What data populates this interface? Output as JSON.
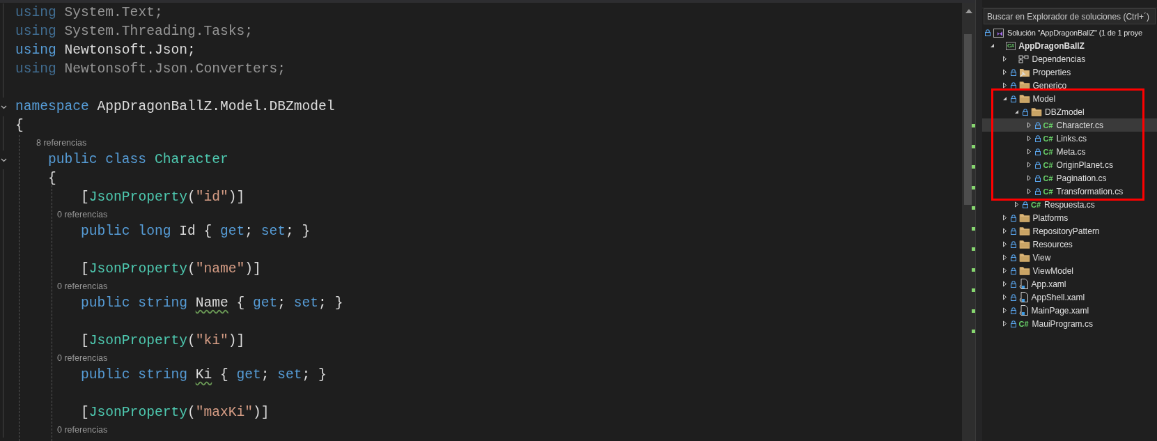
{
  "editor": {
    "lines": [
      {
        "kind": "code",
        "faded": true,
        "foldable": false,
        "tokens": [
          {
            "text": "using",
            "kind": "keyword"
          },
          {
            "text": " System.Text;",
            "kind": "plain"
          }
        ]
      },
      {
        "kind": "code",
        "faded": true,
        "foldable": false,
        "tokens": [
          {
            "text": "using",
            "kind": "keyword"
          },
          {
            "text": " System.Threading.Tasks;",
            "kind": "plain"
          }
        ]
      },
      {
        "kind": "code",
        "faded": false,
        "foldable": false,
        "tokens": [
          {
            "text": "using",
            "kind": "keyword"
          },
          {
            "text": " Newtonsoft.Json;",
            "kind": "plain"
          }
        ]
      },
      {
        "kind": "code",
        "faded": true,
        "foldable": false,
        "tokens": [
          {
            "text": "using",
            "kind": "keyword"
          },
          {
            "text": " Newtonsoft.Json.Converters;",
            "kind": "plain"
          }
        ]
      },
      {
        "kind": "blank"
      },
      {
        "kind": "code",
        "faded": false,
        "foldable": true,
        "tokens": [
          {
            "text": "namespace",
            "kind": "keyword"
          },
          {
            "text": " AppDragonBallZ.Model.DBZmodel",
            "kind": "plain"
          }
        ]
      },
      {
        "kind": "code",
        "faded": false,
        "foldable": false,
        "tokens": [
          {
            "text": "{",
            "kind": "plain"
          }
        ]
      },
      {
        "kind": "lens",
        "text": "8 referencias"
      },
      {
        "kind": "code",
        "faded": false,
        "foldable": true,
        "tokens": [
          {
            "text": "    public class ",
            "kind": "keyword"
          },
          {
            "text": "Character",
            "kind": "type"
          }
        ]
      },
      {
        "kind": "code",
        "faded": false,
        "foldable": false,
        "tokens": [
          {
            "text": "    {",
            "kind": "plain"
          }
        ]
      },
      {
        "kind": "code",
        "faded": false,
        "foldable": false,
        "tokens": [
          {
            "text": "        [",
            "kind": "plain"
          },
          {
            "text": "JsonProperty",
            "kind": "type"
          },
          {
            "text": "(",
            "kind": "plain"
          },
          {
            "text": "\"id\"",
            "kind": "string"
          },
          {
            "text": ")]",
            "kind": "plain"
          }
        ]
      },
      {
        "kind": "lens",
        "text": "0 referencias"
      },
      {
        "kind": "code",
        "faded": false,
        "foldable": false,
        "tokens": [
          {
            "text": "        public long",
            "kind": "keyword"
          },
          {
            "text": " Id { ",
            "kind": "plain"
          },
          {
            "text": "get",
            "kind": "keyword"
          },
          {
            "text": "; ",
            "kind": "plain"
          },
          {
            "text": "set",
            "kind": "keyword"
          },
          {
            "text": "; }",
            "kind": "plain"
          }
        ]
      },
      {
        "kind": "blank"
      },
      {
        "kind": "code",
        "faded": false,
        "foldable": false,
        "tokens": [
          {
            "text": "        [",
            "kind": "plain"
          },
          {
            "text": "JsonProperty",
            "kind": "type"
          },
          {
            "text": "(",
            "kind": "plain"
          },
          {
            "text": "\"name\"",
            "kind": "string"
          },
          {
            "text": ")]",
            "kind": "plain"
          }
        ]
      },
      {
        "kind": "lens",
        "text": "0 referencias"
      },
      {
        "kind": "code",
        "faded": false,
        "foldable": false,
        "tokens": [
          {
            "text": "        public string ",
            "kind": "keyword"
          },
          {
            "text": "Name",
            "kind": "squiggled"
          },
          {
            "text": " { ",
            "kind": "plain"
          },
          {
            "text": "get",
            "kind": "keyword"
          },
          {
            "text": "; ",
            "kind": "plain"
          },
          {
            "text": "set",
            "kind": "keyword"
          },
          {
            "text": "; }",
            "kind": "plain"
          }
        ]
      },
      {
        "kind": "blank"
      },
      {
        "kind": "code",
        "faded": false,
        "foldable": false,
        "tokens": [
          {
            "text": "        [",
            "kind": "plain"
          },
          {
            "text": "JsonProperty",
            "kind": "type"
          },
          {
            "text": "(",
            "kind": "plain"
          },
          {
            "text": "\"ki\"",
            "kind": "string"
          },
          {
            "text": ")]",
            "kind": "plain"
          }
        ]
      },
      {
        "kind": "lens",
        "text": "0 referencias"
      },
      {
        "kind": "code",
        "faded": false,
        "foldable": false,
        "tokens": [
          {
            "text": "        public string ",
            "kind": "keyword"
          },
          {
            "text": "Ki",
            "kind": "squiggled"
          },
          {
            "text": " { ",
            "kind": "plain"
          },
          {
            "text": "get",
            "kind": "keyword"
          },
          {
            "text": "; ",
            "kind": "plain"
          },
          {
            "text": "set",
            "kind": "keyword"
          },
          {
            "text": "; }",
            "kind": "plain"
          }
        ]
      },
      {
        "kind": "blank"
      },
      {
        "kind": "code",
        "faded": false,
        "foldable": false,
        "tokens": [
          {
            "text": "        [",
            "kind": "plain"
          },
          {
            "text": "JsonProperty",
            "kind": "type"
          },
          {
            "text": "(",
            "kind": "plain"
          },
          {
            "text": "\"maxKi\"",
            "kind": "string"
          },
          {
            "text": ")]",
            "kind": "plain"
          }
        ]
      },
      {
        "kind": "lens",
        "text": "0 referencias"
      }
    ]
  },
  "solution_explorer": {
    "search": {
      "placeholder": "Buscar en Explorador de soluciones (Ctrl+´)"
    },
    "tree": [
      {
        "kind": "solution",
        "label": "Solución \"AppDragonBallZ\"  (1 de 1 proye",
        "locked": true,
        "selected": false,
        "children": [
          {
            "kind": "project",
            "badge": "C#",
            "label": "AppDragonBallZ",
            "locked": false,
            "selected": false,
            "expanded": true,
            "children": [
              {
                "kind": "dependencies",
                "label": "Dependencias",
                "locked": false,
                "selected": false,
                "expanded": false
              },
              {
                "kind": "properties",
                "label": "Properties",
                "locked": true,
                "selected": false,
                "expanded": false
              },
              {
                "kind": "folder",
                "label": "Generico",
                "locked": true,
                "selected": false,
                "expanded": false
              },
              {
                "kind": "folder",
                "label": "Model",
                "locked": true,
                "selected": false,
                "expanded": true,
                "children": [
                  {
                    "kind": "folder",
                    "label": "DBZmodel",
                    "locked": true,
                    "selected": false,
                    "expanded": true,
                    "children": [
                      {
                        "kind": "csharp",
                        "badge": "C#",
                        "label": "Character.cs",
                        "locked": true,
                        "selected": true,
                        "expanded": false
                      },
                      {
                        "kind": "csharp",
                        "badge": "C#",
                        "label": "Links.cs",
                        "locked": true,
                        "selected": false,
                        "expanded": false
                      },
                      {
                        "kind": "csharp",
                        "badge": "C#",
                        "label": "Meta.cs",
                        "locked": true,
                        "selected": false,
                        "expanded": false
                      },
                      {
                        "kind": "csharp",
                        "badge": "C#",
                        "label": "OriginPlanet.cs",
                        "locked": true,
                        "selected": false,
                        "expanded": false
                      },
                      {
                        "kind": "csharp",
                        "badge": "C#",
                        "label": "Pagination.cs",
                        "locked": true,
                        "selected": false,
                        "expanded": false
                      },
                      {
                        "kind": "csharp",
                        "badge": "C#",
                        "label": "Transformation.cs",
                        "locked": true,
                        "selected": false,
                        "expanded": false
                      }
                    ]
                  },
                  {
                    "kind": "csharp",
                    "badge": "C#",
                    "label": "Respuesta.cs",
                    "locked": true,
                    "selected": false,
                    "expanded": false
                  }
                ]
              },
              {
                "kind": "folder",
                "label": "Platforms",
                "locked": true,
                "selected": false,
                "expanded": false
              },
              {
                "kind": "folder",
                "label": "RepositoryPattern",
                "locked": true,
                "selected": false,
                "expanded": false
              },
              {
                "kind": "folder",
                "label": "Resources",
                "locked": true,
                "selected": false,
                "expanded": false
              },
              {
                "kind": "folder",
                "label": "View",
                "locked": true,
                "selected": false,
                "expanded": false
              },
              {
                "kind": "folder",
                "label": "ViewModel",
                "locked": true,
                "selected": false,
                "expanded": false
              },
              {
                "kind": "xaml",
                "label": "App.xaml",
                "locked": true,
                "selected": false,
                "expanded": false
              },
              {
                "kind": "xaml",
                "label": "AppShell.xaml",
                "locked": true,
                "selected": false,
                "expanded": false
              },
              {
                "kind": "xaml",
                "label": "MainPage.xaml",
                "locked": true,
                "selected": false,
                "expanded": false
              },
              {
                "kind": "csharp",
                "badge": "C#",
                "label": "MauiProgram.cs",
                "locked": true,
                "selected": false,
                "expanded": false
              }
            ]
          }
        ]
      }
    ]
  }
}
